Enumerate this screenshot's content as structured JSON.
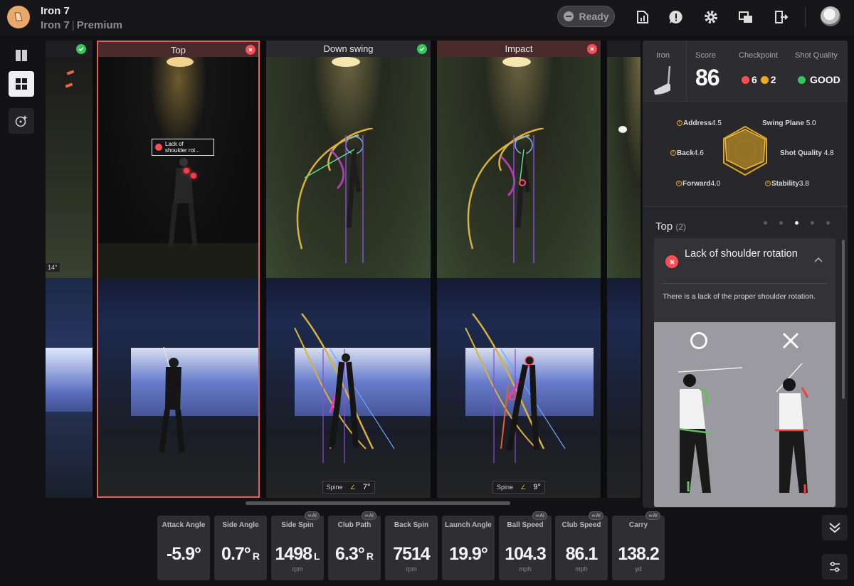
{
  "header": {
    "title": "Iron 7",
    "subtitle_club": "Iron 7",
    "subtitle_tier": "Premium",
    "ready_label": "Ready",
    "icons": [
      "report-icon",
      "alert-icon",
      "gear-icon",
      "display-icon",
      "exit-icon"
    ]
  },
  "sidebar": {
    "buttons": [
      "split-view-icon",
      "grid-view-icon",
      "ai-sparkle-icon"
    ]
  },
  "frames": [
    {
      "label": "",
      "status": "ok"
    },
    {
      "label": "Top",
      "status": "error",
      "selected": true,
      "annotation": "Lack of\nshoulder rot..."
    },
    {
      "label": "Down swing",
      "status": "ok",
      "spine_label": "Spine",
      "spine_value": "7°"
    },
    {
      "label": "Impact",
      "status": "error",
      "spine_label": "Spine",
      "spine_value": "9°"
    }
  ],
  "left_frame_marker": "14°",
  "summary": {
    "club_label": "Iron",
    "score_label": "Score",
    "score": "86",
    "checkpoint_label": "Checkpoint",
    "checkpoint_errors": "6",
    "checkpoint_warnings": "2",
    "shot_quality_label": "Shot Quality",
    "shot_quality": "GOOD"
  },
  "radar": {
    "items": [
      {
        "label": "Address",
        "value": "4.5",
        "info": true
      },
      {
        "label": "Swing Plane",
        "value": "5.0",
        "info": false
      },
      {
        "label": "Back",
        "value": "4.6",
        "info": true
      },
      {
        "label": "Shot Quality",
        "value": "4.8",
        "info": false
      },
      {
        "label": "Forward",
        "value": "4.0",
        "info": true
      },
      {
        "label": "Stability",
        "value": "3.8",
        "info": true
      }
    ]
  },
  "issues": {
    "section_title": "Top",
    "section_count": "(2)",
    "page_dots": 5,
    "active_dot": 3,
    "card_title": "Lack of shoulder rotation",
    "card_description": "There is a lack of the proper shoulder rotation.",
    "good_mark": "O",
    "bad_mark": "X"
  },
  "metrics": [
    {
      "label": "Attack Angle",
      "value": "-5.9°",
      "suffix": "",
      "unit": "",
      "ai": false
    },
    {
      "label": "Side Angle",
      "value": "0.7°",
      "suffix": "R",
      "unit": "",
      "ai": false
    },
    {
      "label": "Side Spin",
      "value": "1498",
      "suffix": "L",
      "unit": "rpm",
      "ai": true
    },
    {
      "label": "Club Path",
      "value": "6.3°",
      "suffix": "R",
      "unit": "",
      "ai": true
    },
    {
      "label": "Back Spin",
      "value": "7514",
      "suffix": "",
      "unit": "rpm",
      "ai": false
    },
    {
      "label": "Launch Angle",
      "value": "19.9°",
      "suffix": "",
      "unit": "",
      "ai": false
    },
    {
      "label": "Ball Speed",
      "value": "104.3",
      "suffix": "",
      "unit": "mph",
      "ai": true
    },
    {
      "label": "Club Speed",
      "value": "86.1",
      "suffix": "",
      "unit": "mph",
      "ai": true
    },
    {
      "label": "Carry",
      "value": "138.2",
      "suffix": "",
      "unit": "yd",
      "ai": true
    }
  ],
  "ai_badge": "AI",
  "colors": {
    "accent_error": "#ff4d58",
    "accent_ok": "#34c759",
    "accent_warn": "#f5a623",
    "radar_gold": "#d9a52b"
  }
}
